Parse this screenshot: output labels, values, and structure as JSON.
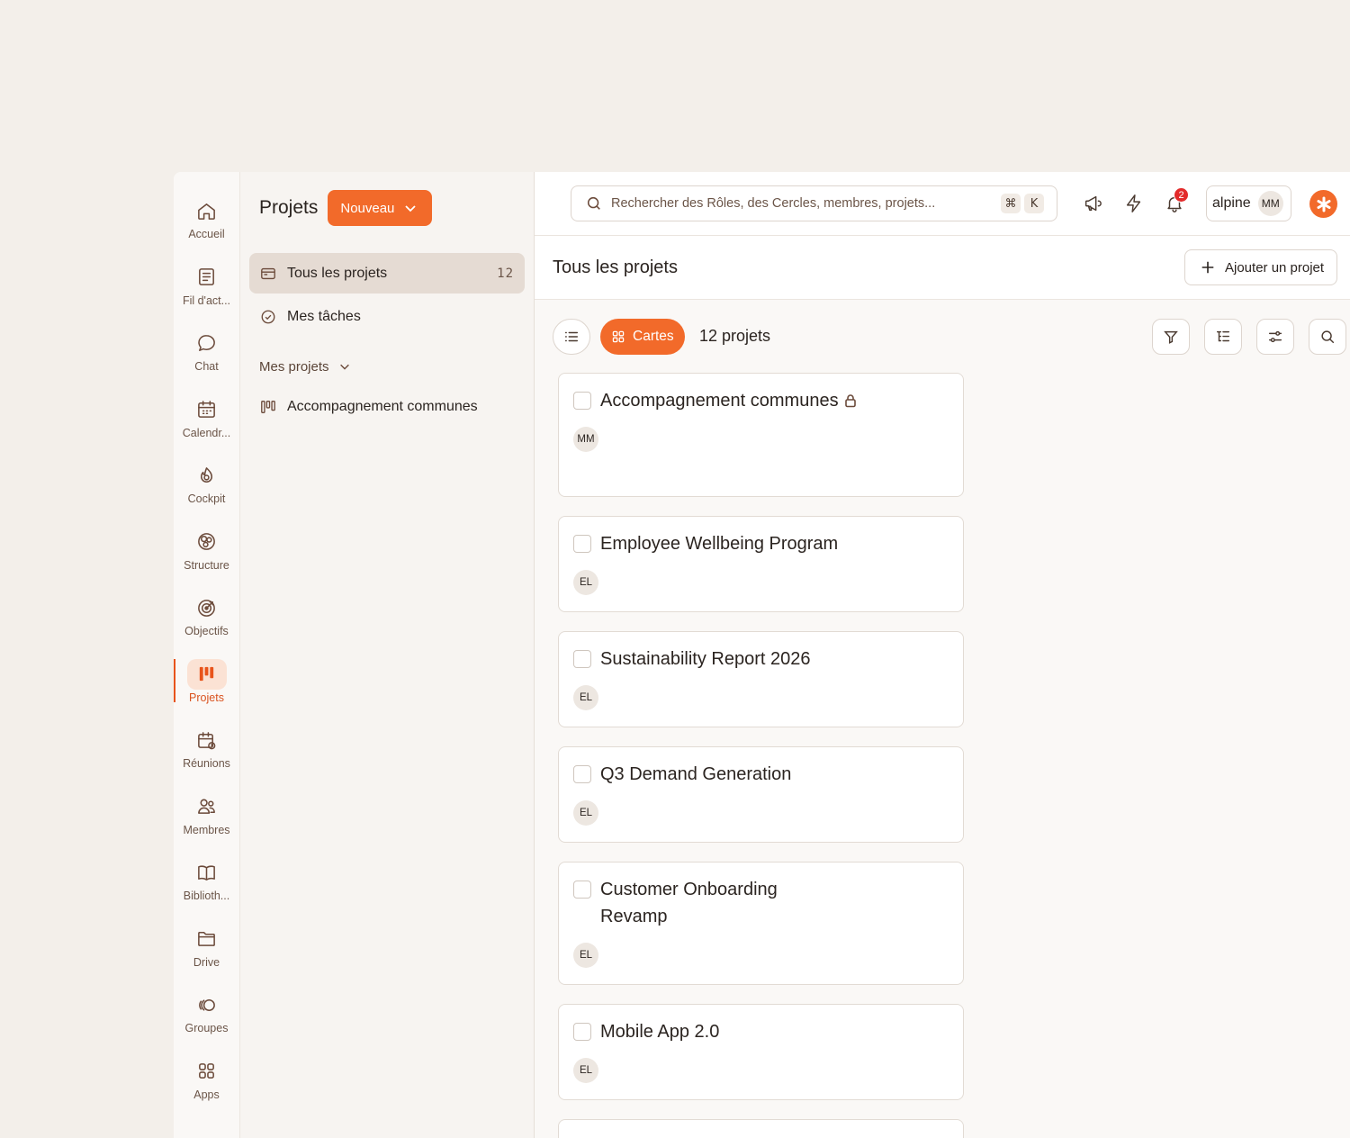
{
  "rail": [
    {
      "label": "Accueil",
      "icon": "home-icon"
    },
    {
      "label": "Fil d'act...",
      "icon": "newsfeed-icon"
    },
    {
      "label": "Chat",
      "icon": "chat-icon"
    },
    {
      "label": "Calendr...",
      "icon": "calendar-icon"
    },
    {
      "label": "Cockpit",
      "icon": "cockpit-icon"
    },
    {
      "label": "Structure",
      "icon": "structure-icon"
    },
    {
      "label": "Objectifs",
      "icon": "target-icon"
    },
    {
      "label": "Projets",
      "icon": "projects-icon",
      "active": true
    },
    {
      "label": "Réunions",
      "icon": "meeting-icon"
    },
    {
      "label": "Membres",
      "icon": "members-icon"
    },
    {
      "label": "Biblioth...",
      "icon": "library-icon"
    },
    {
      "label": "Drive",
      "icon": "folder-icon"
    },
    {
      "label": "Groupes",
      "icon": "groups-icon"
    },
    {
      "label": "Apps",
      "icon": "apps-icon"
    }
  ],
  "panel": {
    "title": "Projets",
    "new_label": "Nouveau",
    "all_projects": "Tous les projets",
    "all_projects_count": "12",
    "my_tasks": "Mes tâches",
    "my_projects": "Mes projets",
    "project_link": "Accompagnement communes"
  },
  "topbar": {
    "search_placeholder": "Rechercher des Rôles, des Cercles, membres, projets...",
    "kbd_cmd": "⌘",
    "kbd_k": "K",
    "notification_count": "2",
    "org_name": "alpine",
    "user_initials": "MM"
  },
  "main": {
    "title": "Tous les projets",
    "add_label": "Ajouter un projet",
    "cards_label": "Cartes",
    "count_label": "12 projets"
  },
  "projects": [
    {
      "title": "Accompagnement communes",
      "owner": "MM",
      "locked": true
    },
    {
      "title": "Employee Wellbeing Program",
      "owner": "EL"
    },
    {
      "title": "Sustainability Report 2026",
      "owner": "EL"
    },
    {
      "title": "Q3 Demand Generation",
      "owner": "EL"
    },
    {
      "title": "Customer Onboarding Revamp",
      "owner": "EL"
    },
    {
      "title": "Mobile App 2.0",
      "owner": "EL"
    }
  ],
  "colors": {
    "accent": "#f26a2a",
    "badge": "#e32b2b"
  }
}
